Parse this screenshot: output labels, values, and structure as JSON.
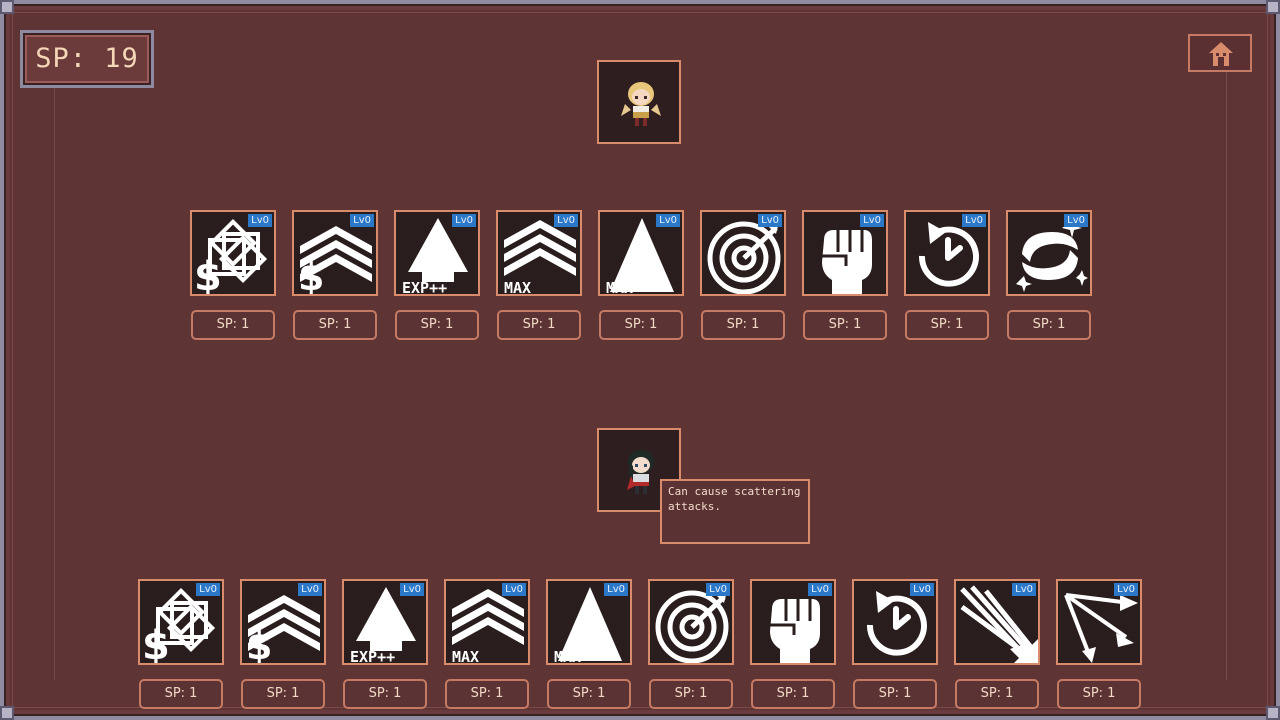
{
  "sp_display": "SP: 19",
  "icons": {
    "home": "home-icon"
  },
  "colors": {
    "background": "#5e3435",
    "level_badge": "#2c78c8",
    "border_accent": "#d88c6c"
  },
  "characters": [
    {
      "portrait": "blonde-hero-sprite",
      "skills": [
        {
          "icon": "gold-bonus-icon",
          "level": "Lv0",
          "cost": "SP: 1"
        },
        {
          "icon": "gold-rank-up-icon",
          "level": "Lv0",
          "cost": "SP: 1"
        },
        {
          "icon": "exp-boost-icon",
          "level": "Lv0",
          "cost": "SP: 1",
          "glyph": "EXP++"
        },
        {
          "icon": "max-rank-up-icon",
          "level": "Lv0",
          "cost": "SP: 1",
          "glyph": "MAX"
        },
        {
          "icon": "max-up-icon",
          "level": "Lv0",
          "cost": "SP: 1",
          "glyph": "MAX"
        },
        {
          "icon": "target-icon",
          "level": "Lv0",
          "cost": "SP: 1"
        },
        {
          "icon": "fist-icon",
          "level": "Lv0",
          "cost": "SP: 1"
        },
        {
          "icon": "cooldown-timer-icon",
          "level": "Lv0",
          "cost": "SP: 1"
        },
        {
          "icon": "swirl-icon",
          "level": "Lv0",
          "cost": "SP: 1"
        }
      ]
    },
    {
      "portrait": "dark-haired-hero-sprite",
      "skills": [
        {
          "icon": "gold-bonus-icon",
          "level": "Lv0",
          "cost": "SP: 1"
        },
        {
          "icon": "gold-rank-up-icon",
          "level": "Lv0",
          "cost": "SP: 1"
        },
        {
          "icon": "exp-boost-icon",
          "level": "Lv0",
          "cost": "SP: 1",
          "glyph": "EXP++"
        },
        {
          "icon": "max-rank-up-icon",
          "level": "Lv0",
          "cost": "SP: 1",
          "glyph": "MAX"
        },
        {
          "icon": "max-up-icon",
          "level": "Lv0",
          "cost": "SP: 1",
          "glyph": "MAX"
        },
        {
          "icon": "target-icon",
          "level": "Lv0",
          "cost": "SP: 1"
        },
        {
          "icon": "fist-icon",
          "level": "Lv0",
          "cost": "SP: 1"
        },
        {
          "icon": "cooldown-timer-icon",
          "level": "Lv0",
          "cost": "SP: 1"
        },
        {
          "icon": "scatter-arrows-icon",
          "level": "Lv0",
          "cost": "SP: 1"
        },
        {
          "icon": "multi-arrows-icon",
          "level": "Lv0",
          "cost": "SP: 1"
        }
      ]
    }
  ],
  "tooltip": "Can cause scattering attacks."
}
